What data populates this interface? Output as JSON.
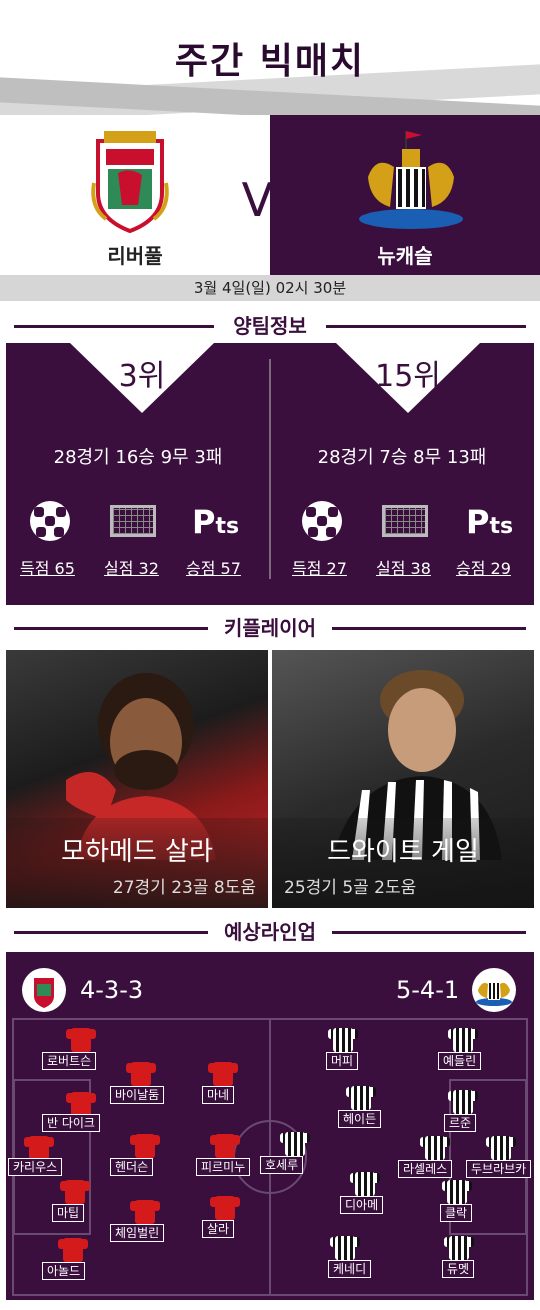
{
  "header": {
    "title": "주간 빅매치"
  },
  "match": {
    "home": "리버풀",
    "away": "뉴캐슬",
    "vs": "VS",
    "date": "3월 4일(일) 02시 30분"
  },
  "sections": {
    "team_info": "양팀정보",
    "key_player": "키플레이어",
    "lineup": "예상라인업"
  },
  "team_info": {
    "home": {
      "rank": "3위",
      "record": "28경기 16승 9무 3패",
      "goals": "득점 65",
      "conceded": "실점 32",
      "points": "승점 57"
    },
    "away": {
      "rank": "15위",
      "record": "28경기 7승 8무 13패",
      "goals": "득점 27",
      "conceded": "실점 38",
      "points": "승점 29"
    },
    "pts_label": "Pts"
  },
  "key_players": {
    "home": {
      "name": "모하메드 살라",
      "stats": "27경기 23골 8도움"
    },
    "away": {
      "name": "드와이트 게일",
      "stats": "25경기 5골 2도움"
    }
  },
  "lineup": {
    "home_formation": "4-3-3",
    "away_formation": "5-4-1",
    "home_players": [
      "로버트슨",
      "바이날둠",
      "마네",
      "반 다이크",
      "카리우스",
      "헨더슨",
      "피르미누",
      "마팁",
      "체임벌린",
      "살라",
      "아놀드"
    ],
    "away_players": [
      "머피",
      "예들린",
      "헤이든",
      "르준",
      "호세루",
      "라셀레스",
      "두브라브카",
      "디아메",
      "클락",
      "케네디",
      "듀멧"
    ]
  },
  "colors": {
    "primary": "#3a0f3e",
    "liverpool": "#d41a1a"
  }
}
